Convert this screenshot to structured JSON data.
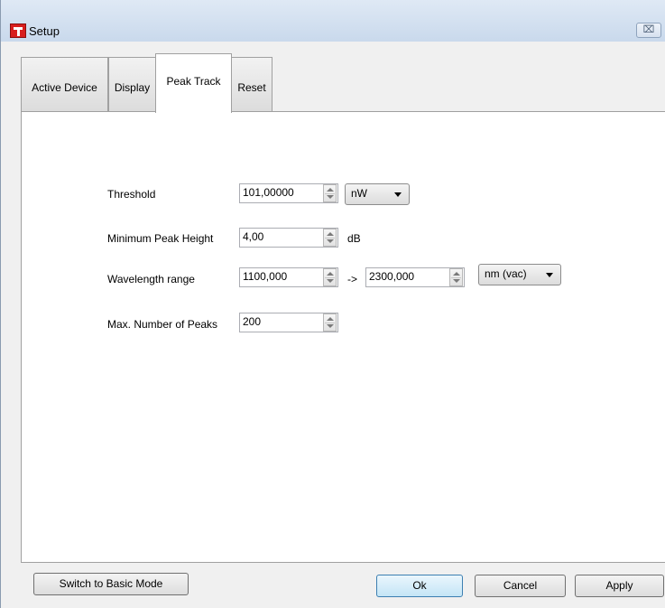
{
  "window": {
    "title": "Setup",
    "close_label": "⌧"
  },
  "tabs": [
    {
      "label": "Active Device",
      "active": false
    },
    {
      "label": "Display",
      "active": false
    },
    {
      "label": "Peak Track",
      "active": true
    },
    {
      "label": "Reset",
      "active": false
    }
  ],
  "peak_track": {
    "threshold": {
      "label": "Threshold",
      "value": "101,00000",
      "unit": "nW"
    },
    "min_peak_height": {
      "label": "Minimum Peak Height",
      "value": "4,00",
      "unit": "dB"
    },
    "wavelength_range": {
      "label": "Wavelength range",
      "from": "1100,000",
      "arrow": "->",
      "to": "2300,000",
      "unit": "nm (vac)"
    },
    "max_peaks": {
      "label": "Max. Number of Peaks",
      "value": "200"
    }
  },
  "buttons": {
    "basic_mode": "Switch to Basic Mode",
    "ok": "Ok",
    "cancel": "Cancel",
    "apply": "Apply"
  }
}
